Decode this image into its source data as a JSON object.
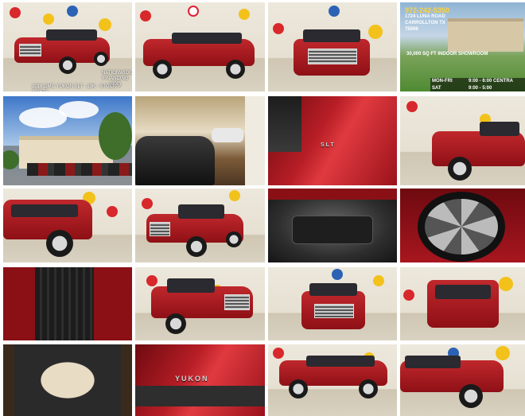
{
  "thumbnails": [
    {
      "id": "photo-1",
      "kind": "front-3q",
      "caption": "2016 GMC YUKON SLT - 19K - STOCK # 294673",
      "badge": "NATIONWIDE FINANCING (800)"
    },
    {
      "id": "photo-2",
      "kind": "side"
    },
    {
      "id": "photo-3",
      "kind": "front"
    },
    {
      "id": "photo-4",
      "kind": "info"
    },
    {
      "id": "photo-5",
      "kind": "dealership"
    },
    {
      "id": "photo-6",
      "kind": "interior-showroom"
    },
    {
      "id": "photo-7",
      "kind": "detail-slt",
      "badge": "SLT"
    },
    {
      "id": "photo-8",
      "kind": "rear-3q"
    },
    {
      "id": "photo-9",
      "kind": "rear-3q-left"
    },
    {
      "id": "photo-10",
      "kind": "front-3q"
    },
    {
      "id": "photo-11",
      "kind": "engine"
    },
    {
      "id": "photo-12",
      "kind": "wheel"
    },
    {
      "id": "photo-13",
      "kind": "tire"
    },
    {
      "id": "photo-14",
      "kind": "front-3q-right"
    },
    {
      "id": "photo-15",
      "kind": "front"
    },
    {
      "id": "photo-16",
      "kind": "rear"
    },
    {
      "id": "photo-17",
      "kind": "cargo"
    },
    {
      "id": "photo-18",
      "kind": "badge-yukon",
      "badge": "YUKON"
    },
    {
      "id": "photo-19",
      "kind": "side"
    },
    {
      "id": "photo-20",
      "kind": "front-3q-left"
    }
  ],
  "dealer_info": {
    "phone": "972-242-5350",
    "address": "1724 LUNA ROAD",
    "city": "CARROLLTON TX",
    "zip": "75006",
    "showroom": "30,000 SQ FT INDOOR SHOWROOM",
    "hours_weekday_label": "MON-FRI",
    "hours_weekday": "9:00 - 6:00 CENTRA",
    "hours_sat_label": "SAT",
    "hours_sat": "9:00 - 5:00"
  },
  "colors": {
    "paint": "#b81e26",
    "background": "#ffffff"
  }
}
